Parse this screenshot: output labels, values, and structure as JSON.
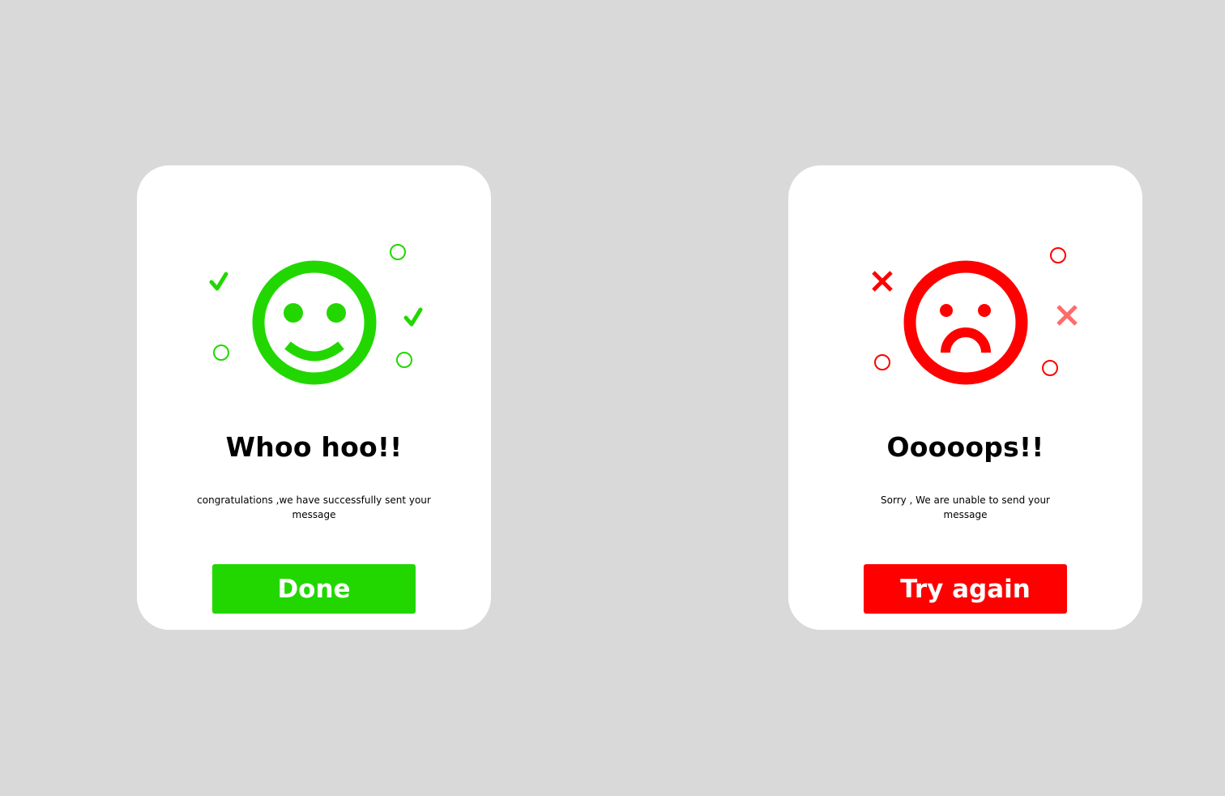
{
  "colors": {
    "background": "#d9d9d9",
    "card": "#ffffff",
    "success": "#22d700",
    "error": "#ff0000",
    "error_light": "#ff6b6b"
  },
  "success_dialog": {
    "icon": "happy-face-icon",
    "title": "Whoo hoo!!",
    "message": "congratulations ,we have successfully sent your message",
    "button_label": "Done"
  },
  "error_dialog": {
    "icon": "sad-face-icon",
    "title": "Ooooops!!",
    "message": "Sorry , We are unable to send your message",
    "button_label": "Try again"
  }
}
